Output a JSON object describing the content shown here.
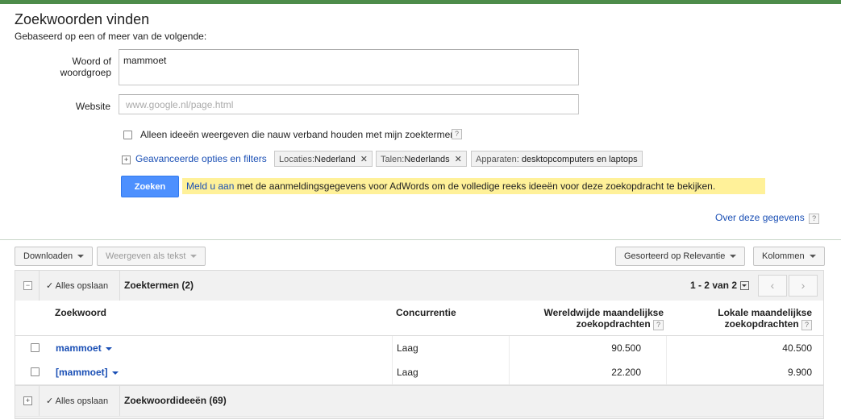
{
  "page": {
    "title": "Zoekwoorden vinden",
    "subtitle": "Gebaseerd op een of meer van de volgende:"
  },
  "form": {
    "keyword_label": "Woord of woordgroep",
    "keyword_value": "mammoet",
    "website_label": "Website",
    "website_placeholder": "www.google.nl/page.html",
    "related_only_label": "Alleen ideeën weergeven die nauw verband houden met mijn zoektermen",
    "help": "?",
    "advanced_link": "Geavanceerde opties en filters",
    "filters": [
      {
        "key": "Locaties:",
        "value": "Nederland",
        "removable": true
      },
      {
        "key": "Talen:",
        "value": "Nederlands",
        "removable": true
      },
      {
        "key": "Apparaten:",
        "value": "desktopcomputers en laptops",
        "removable": false
      }
    ],
    "search_button": "Zoeken",
    "signin_link": "Meld u aan",
    "signin_notice": "met de aanmeldingsgegevens voor AdWords om de volledige reeks ideeën voor deze zoekopdracht te bekijken.",
    "about_link": "Over deze gegevens"
  },
  "toolbar": {
    "download": "Downloaden",
    "show_as_text": "Weergeven als tekst",
    "sort": "Gesorteerd op Relevantie",
    "columns": "Kolommen"
  },
  "table": {
    "save_all": "Alles opslaan",
    "group1_title": "Zoektermen (2)",
    "pager": "1 - 2 van 2",
    "prev": "‹",
    "next": "›",
    "columns": {
      "keyword": "Zoekwoord",
      "competition": "Concurrentie",
      "global": "Wereldwijde maandelijkse zoekopdrachten",
      "local": "Lokale maandelijkse zoekopdrachten"
    },
    "rows": [
      {
        "keyword": "mammoet",
        "competition": "Laag",
        "global": "90.500",
        "local": "40.500"
      },
      {
        "keyword": "[mammoet]",
        "competition": "Laag",
        "global": "22.200",
        "local": "9.900"
      }
    ],
    "group2_title": "Zoekwoordideeën (69)"
  },
  "colors": {
    "topbar": "#4d8c4a",
    "link": "#1a4fb5",
    "primary_button": "#4d90fe",
    "notice_bg": "#fff199"
  }
}
